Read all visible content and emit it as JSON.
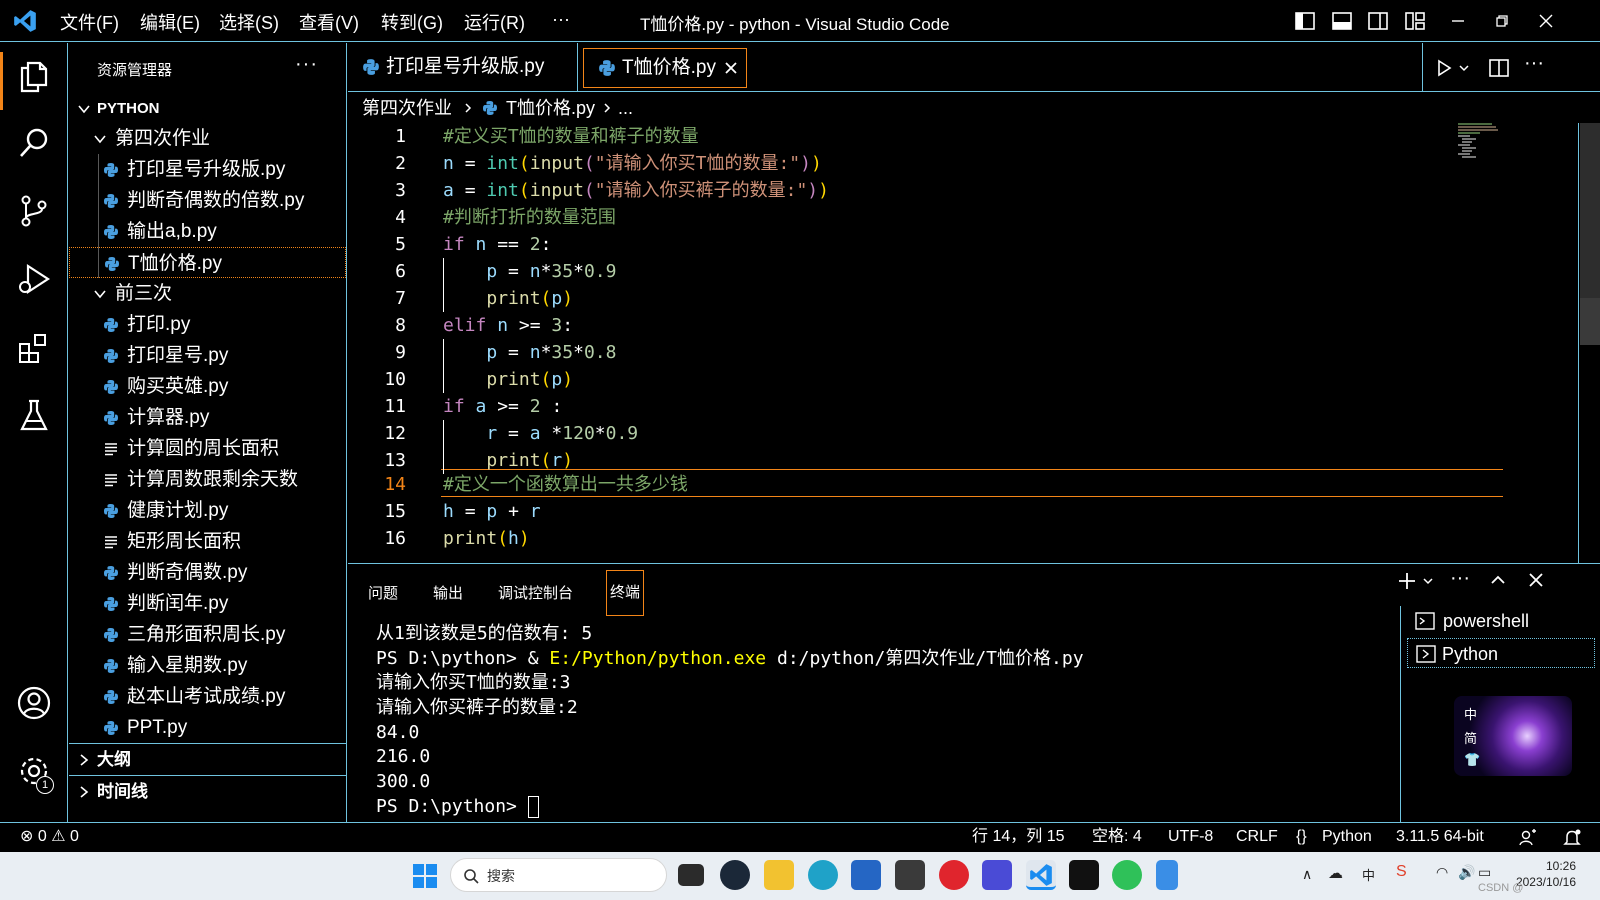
{
  "window": {
    "title": "T恤价格.py - python - Visual Studio Code",
    "menu": [
      "文件(F)",
      "编辑(E)",
      "选择(S)",
      "查看(V)",
      "转到(G)",
      "运行(R)",
      "···"
    ]
  },
  "sidebar": {
    "title": "资源管理器",
    "more": "···",
    "root": "PYTHON",
    "folder1": {
      "name": "第四次作业",
      "files": [
        "打印星号升级版.py",
        "判断奇偶数的倍数.py",
        "输出a,b.py",
        "T恤价格.py"
      ]
    },
    "folder2": {
      "name": "前三次",
      "files": [
        "打印.py",
        "打印星号.py",
        "购买英雄.py",
        "计算器.py",
        "计算圆的周长面积",
        "计算周数跟剩余天数",
        "健康计划.py",
        "矩形周长面积",
        "判断奇偶数.py",
        "判断闰年.py",
        "三角形面积周长.py",
        "输入星期数.py",
        "赵本山考试成绩.py",
        "PPT.py"
      ]
    },
    "outline": "大纲",
    "timeline": "时间线"
  },
  "tabs": [
    {
      "label": "打印星号升级版.py",
      "active": false
    },
    {
      "label": "T恤价格.py",
      "active": true
    }
  ],
  "breadcrumb": {
    "folder": "第四次作业",
    "file": "T恤价格.py",
    "more": "..."
  },
  "editor": {
    "current_line": 14,
    "line_numbers": [
      "1",
      "2",
      "3",
      "4",
      "5",
      "6",
      "7",
      "8",
      "9",
      "10",
      "11",
      "12",
      "13",
      "14",
      "15",
      "16"
    ]
  },
  "panel": {
    "tabs": [
      "问题",
      "输出",
      "调试控制台",
      "终端"
    ],
    "active_tab": "终端",
    "terminal_lines": [
      "从1到该数是5的倍数有: 5",
      "PS D:\\python> & ",
      "请输入你买T恤的数量:3",
      "请输入你买裤子的数量:2",
      "84.0",
      "216.0",
      "300.0",
      "PS D:\\python> "
    ],
    "terminal_cmd_exe": "E:/Python/python.exe",
    "terminal_cmd_arg": " d:/python/第四次作业/T恤价格.py",
    "terminals": [
      "powershell",
      "Python"
    ],
    "ime": [
      "中",
      "简"
    ]
  },
  "statusbar": {
    "errors": "0",
    "warnings": "0",
    "position": "行 14，列 15",
    "spaces": "空格: 4",
    "encoding": "UTF-8",
    "eol": "CRLF",
    "language": "Python",
    "interpreter": "3.11.5 64-bit"
  },
  "activity_badge": "1",
  "taskbar": {
    "search_placeholder": "搜索",
    "time": "10:26",
    "date": "2023/10/16",
    "watermark": "CSDN @"
  }
}
